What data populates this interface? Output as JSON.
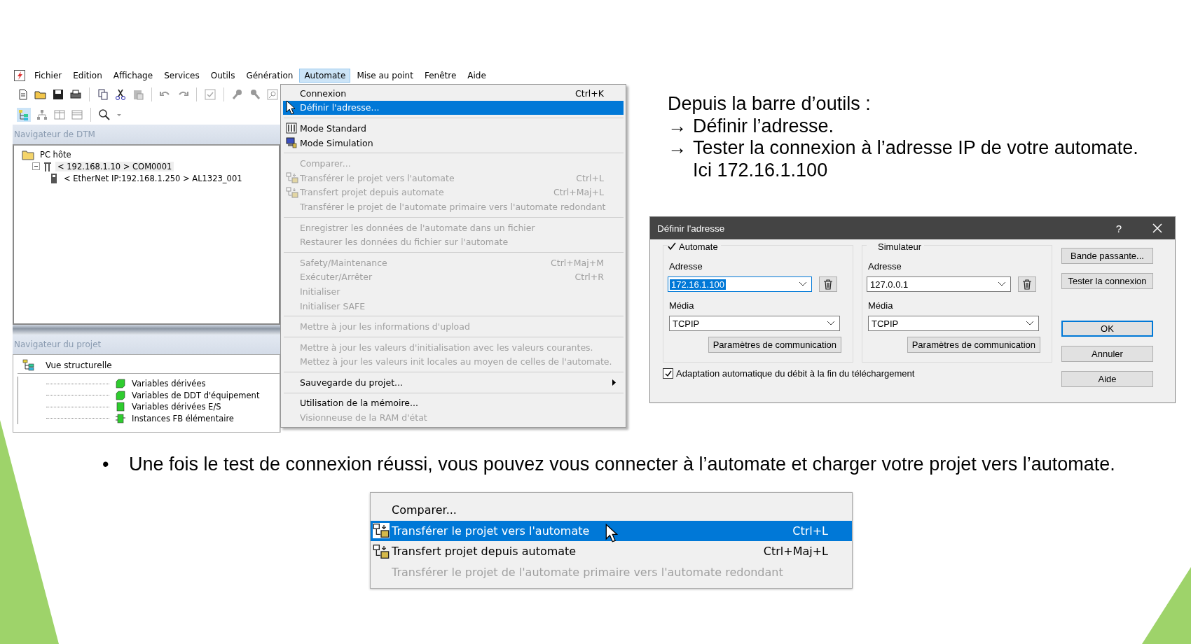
{
  "app": {
    "menu_bar": [
      {
        "label": "Fichier",
        "selected": false
      },
      {
        "label": "Edition",
        "selected": false
      },
      {
        "label": "Affichage",
        "selected": false
      },
      {
        "label": "Services",
        "selected": false
      },
      {
        "label": "Outils",
        "selected": false
      },
      {
        "label": "Génération",
        "selected": false
      },
      {
        "label": "Automate",
        "selected": true
      },
      {
        "label": "Mise au point",
        "selected": false
      },
      {
        "label": "Fenêtre",
        "selected": false
      },
      {
        "label": "Aide",
        "selected": false
      }
    ],
    "dtm_navigator": {
      "title": "Navigateur de DTM",
      "tree": [
        {
          "label": "PC hôte",
          "kind": "folder",
          "selected": false,
          "children": [
            {
              "label": "< 192.168.1.10 > COM0001",
              "kind": "bus",
              "expanded": true,
              "selected": true,
              "children": [
                {
                  "label": "< EtherNet IP:192.168.1.250 > AL1323_001",
                  "kind": "device",
                  "selected": false
                }
              ]
            }
          ]
        }
      ]
    },
    "project_navigator": {
      "title": "Navigateur du projet",
      "view": "Vue structurelle",
      "items": [
        {
          "label": "Variables dérivées",
          "kind": "block"
        },
        {
          "label": "Variables de DDT d'équipement",
          "kind": "block"
        },
        {
          "label": "Variables dérivées E/S",
          "kind": "square"
        },
        {
          "label": "Instances FB élémentaire",
          "kind": "fb"
        }
      ]
    },
    "dropdown_menu": {
      "items": [
        {
          "kind": "item",
          "label": "Connexion",
          "shortcut": "Ctrl+K",
          "selected": false,
          "disabled": false
        },
        {
          "kind": "item",
          "label": "Définir l'adresse...",
          "selected": true,
          "disabled": false
        },
        {
          "kind": "separator"
        },
        {
          "kind": "standard",
          "label": "Mode Standard",
          "selected": false,
          "disabled": false
        },
        {
          "kind": "simulation",
          "label": "Mode Simulation",
          "selected": false,
          "disabled": false
        },
        {
          "kind": "separator"
        },
        {
          "kind": "item",
          "label": "Comparer...",
          "selected": false,
          "disabled": true
        },
        {
          "kind": "transfer",
          "label": "Transférer le projet vers l'automate",
          "shortcut": "Ctrl+L",
          "selected": false,
          "disabled": true
        },
        {
          "kind": "transfer",
          "label": "Transfert projet depuis automate",
          "shortcut": "Ctrl+Maj+L",
          "selected": false,
          "disabled": true
        },
        {
          "kind": "item",
          "label": "Transférer le projet de l'automate primaire vers l'automate redondant",
          "selected": false,
          "disabled": true
        },
        {
          "kind": "separator"
        },
        {
          "kind": "item",
          "label": "Enregistrer les données de l'automate dans un fichier",
          "selected": false,
          "disabled": true
        },
        {
          "kind": "item",
          "label": "Restaurer les données du fichier sur l'automate",
          "selected": false,
          "disabled": true
        },
        {
          "kind": "separator"
        },
        {
          "kind": "item",
          "label": "Safety/Maintenance",
          "shortcut": "Ctrl+Maj+M",
          "selected": false,
          "disabled": true
        },
        {
          "kind": "item",
          "label": "Exécuter/Arrêter",
          "shortcut": "Ctrl+R",
          "selected": false,
          "disabled": true
        },
        {
          "kind": "item",
          "label": "Initialiser",
          "selected": false,
          "disabled": true
        },
        {
          "kind": "item",
          "label": "Initialiser SAFE",
          "selected": false,
          "disabled": true
        },
        {
          "kind": "separator"
        },
        {
          "kind": "item",
          "label": "Mettre à jour les informations d'upload",
          "selected": false,
          "disabled": true
        },
        {
          "kind": "separator"
        },
        {
          "kind": "item",
          "label": "Mettre à jour les valeurs d'initialisation avec les valeurs courantes.",
          "selected": false,
          "disabled": true
        },
        {
          "kind": "item",
          "label": "Mettez à jour les valeurs init locales au moyen de celles de l'automate.",
          "selected": false,
          "disabled": true
        },
        {
          "kind": "separator"
        },
        {
          "kind": "submenu",
          "label": "Sauvegarde du projet...",
          "selected": false,
          "disabled": false
        },
        {
          "kind": "separator"
        },
        {
          "kind": "item",
          "label": "Utilisation de la mémoire...",
          "selected": false,
          "disabled": false
        },
        {
          "kind": "item",
          "label": "Visionneuse de la RAM d'état",
          "selected": false,
          "disabled": true
        }
      ]
    }
  },
  "instructions": {
    "heading": "Depuis la barre d’outils :",
    "steps": [
      {
        "marker": "→",
        "text": "Définir l’adresse."
      },
      {
        "marker": "→",
        "text": "Tester la connexion à l’adresse IP de votre automate.",
        "continuation": "Ici 172.16.1.100"
      }
    ]
  },
  "dialog": {
    "title": "Définir l'adresse",
    "help": "?",
    "groups": [
      {
        "label": "Automate",
        "checked": true,
        "address_label": "Adresse",
        "address": "172.16.1.100",
        "address_selected": true,
        "media_label": "Média",
        "media": "TCPIP",
        "button": "Paramètres de communication"
      },
      {
        "label": "Simulateur",
        "checked": false,
        "address_label": "Adresse",
        "address": "127.0.0.1",
        "address_selected": false,
        "media_label": "Média",
        "media": "TCPIP",
        "button": "Paramètres de communication"
      }
    ],
    "top_buttons": [
      {
        "label": "Bande passante...",
        "default": false
      },
      {
        "label": "Tester la connexion",
        "default": false
      }
    ],
    "bottom_buttons": [
      {
        "label": "OK",
        "default": true
      },
      {
        "label": "Annuler",
        "default": false
      },
      {
        "label": "Aide",
        "default": false
      }
    ],
    "auto_rate": {
      "label": "Adaptation automatique du débit à la fin du téléchargement",
      "checked": true
    }
  },
  "bullet": {
    "marker": "•",
    "text": "Une fois le test de connexion réussi, vous pouvez vous connecter à l’automate et charger votre projet vers l’automate."
  },
  "menu_excerpt": {
    "items": [
      {
        "kind": "item",
        "label": "Comparer...",
        "selected": false,
        "disabled": false
      },
      {
        "kind": "transfer",
        "label": "Transférer le projet vers l'automate",
        "shortcut": "Ctrl+L",
        "selected": true,
        "disabled": false
      },
      {
        "kind": "transfer",
        "label": "Transfert projet depuis automate",
        "shortcut": "Ctrl+Maj+L",
        "selected": false,
        "disabled": false
      },
      {
        "kind": "item",
        "label": "Transférer le projet de l'automate primaire vers l'automate redondant",
        "selected": false,
        "disabled": true
      }
    ]
  }
}
